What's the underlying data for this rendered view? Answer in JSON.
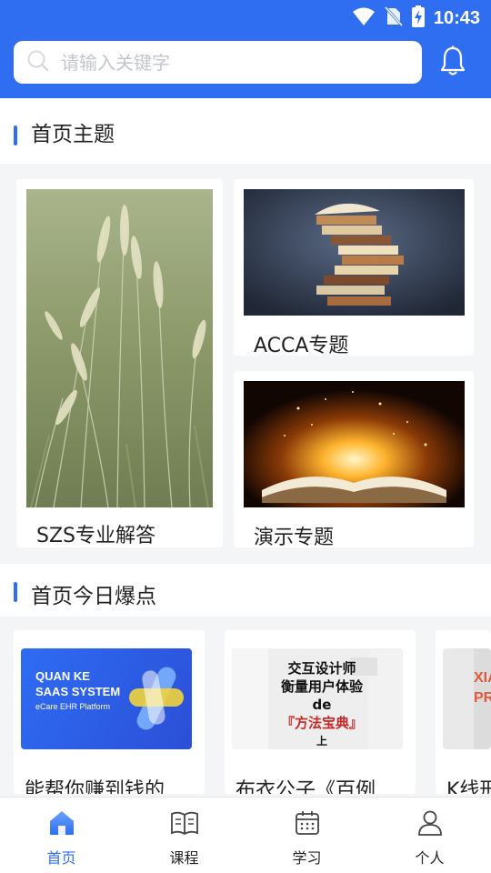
{
  "status": {
    "time": "10:43"
  },
  "search": {
    "placeholder": "请输入关键字"
  },
  "sections": {
    "topics": {
      "title": "首页主题"
    },
    "hot": {
      "title": "首页今日爆点"
    }
  },
  "topics": [
    {
      "label": "SZS专业解答"
    },
    {
      "label": "ACCA专题"
    },
    {
      "label": "演示专题"
    }
  ],
  "hot": [
    {
      "title": "能帮你赚到钱的",
      "thumb_lines": [
        "QUAN KE",
        "SAAS SYSTEM",
        "eCare EHR Platform"
      ]
    },
    {
      "title": "布衣公子《百例",
      "thumb_lines": [
        "交互设计师",
        "衡量用户体验de",
        "『方法宝典』",
        "上"
      ]
    },
    {
      "title": "K线形",
      "thumb_lines": [
        "XIA",
        "PR"
      ]
    }
  ],
  "nav": [
    {
      "label": "首页",
      "icon": "home-icon",
      "active": true
    },
    {
      "label": "课程",
      "icon": "book-icon",
      "active": false
    },
    {
      "label": "学习",
      "icon": "calendar-icon",
      "active": false
    },
    {
      "label": "个人",
      "icon": "person-icon",
      "active": false
    }
  ],
  "colors": {
    "primary": "#2f6ef0",
    "background": "#f4f5f7"
  }
}
